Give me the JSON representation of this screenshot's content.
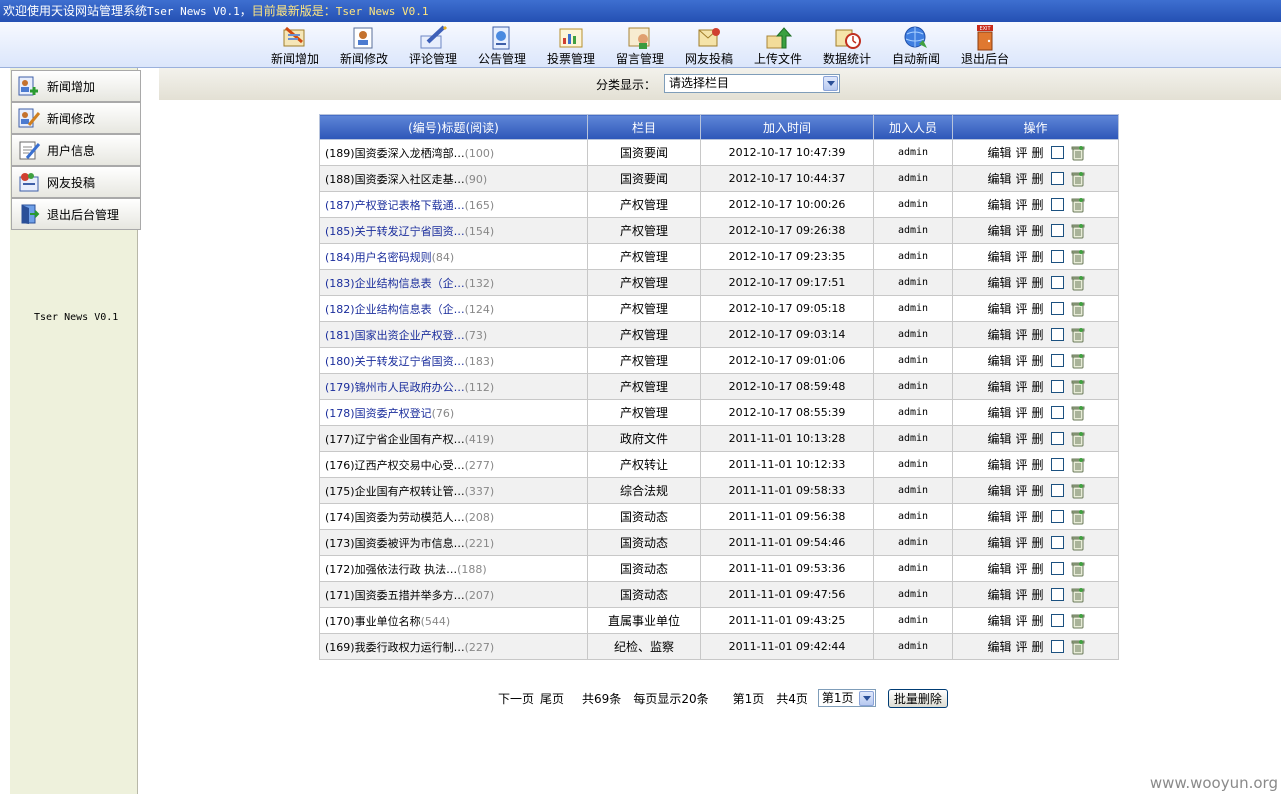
{
  "topbar": {
    "welcome": "欢迎使用天设网站管理系统",
    "version": "Tser News V0.1",
    "sep": "，",
    "latest_label": "目前最新版是：",
    "latest_version": "Tser News V0.1"
  },
  "toolbar": {
    "items": [
      {
        "label": "新闻增加",
        "icon": "news-add-icon"
      },
      {
        "label": "新闻修改",
        "icon": "news-edit-icon"
      },
      {
        "label": "评论管理",
        "icon": "comment-icon"
      },
      {
        "label": "公告管理",
        "icon": "notice-icon"
      },
      {
        "label": "投票管理",
        "icon": "vote-icon"
      },
      {
        "label": "留言管理",
        "icon": "message-icon"
      },
      {
        "label": "网友投稿",
        "icon": "submission-icon"
      },
      {
        "label": "上传文件",
        "icon": "upload-icon"
      },
      {
        "label": "数据统计",
        "icon": "stats-icon"
      },
      {
        "label": "自动新闻",
        "icon": "auto-news-icon"
      },
      {
        "label": "退出后台",
        "icon": "exit-icon"
      }
    ]
  },
  "sidebar": {
    "items": [
      {
        "label": "新闻增加"
      },
      {
        "label": "新闻修改"
      },
      {
        "label": "用户信息"
      },
      {
        "label": "网友投稿"
      },
      {
        "label": "退出后台管理"
      }
    ],
    "version": "Tser News V0.1"
  },
  "filter": {
    "label": "分类显示：",
    "selected": "请选择栏目"
  },
  "table": {
    "headers": [
      "(编号)标题(阅读)",
      "栏目",
      "加入时间",
      "加入人员",
      "操作"
    ],
    "op_labels": {
      "edit": "编辑",
      "comment": "评",
      "delete": "删"
    },
    "rows": [
      {
        "title": "(189)国资委深入龙栖湾部…",
        "reads": "(100)",
        "blue": false,
        "category": "国资要闻",
        "time": "2012-10-17 10:47:39",
        "user": "admin"
      },
      {
        "title": "(188)国资委深入社区走基…",
        "reads": "(90)",
        "blue": false,
        "category": "国资要闻",
        "time": "2012-10-17 10:44:37",
        "user": "admin"
      },
      {
        "title": "(187)产权登记表格下载通…",
        "reads": "(165)",
        "blue": true,
        "category": "产权管理",
        "time": "2012-10-17 10:00:26",
        "user": "admin"
      },
      {
        "title": "(185)关于转发辽宁省国资…",
        "reads": "(154)",
        "blue": true,
        "category": "产权管理",
        "time": "2012-10-17 09:26:38",
        "user": "admin"
      },
      {
        "title": "(184)用户名密码规则",
        "reads": "(84)",
        "blue": true,
        "category": "产权管理",
        "time": "2012-10-17 09:23:35",
        "user": "admin"
      },
      {
        "title": "(183)企业结构信息表（企…",
        "reads": "(132)",
        "blue": true,
        "category": "产权管理",
        "time": "2012-10-17 09:17:51",
        "user": "admin"
      },
      {
        "title": "(182)企业结构信息表（企…",
        "reads": "(124)",
        "blue": true,
        "category": "产权管理",
        "time": "2012-10-17 09:05:18",
        "user": "admin"
      },
      {
        "title": "(181)国家出资企业产权登…",
        "reads": "(73)",
        "blue": true,
        "category": "产权管理",
        "time": "2012-10-17 09:03:14",
        "user": "admin"
      },
      {
        "title": "(180)关于转发辽宁省国资…",
        "reads": "(183)",
        "blue": true,
        "category": "产权管理",
        "time": "2012-10-17 09:01:06",
        "user": "admin"
      },
      {
        "title": "(179)锦州市人民政府办公…",
        "reads": "(112)",
        "blue": true,
        "category": "产权管理",
        "time": "2012-10-17 08:59:48",
        "user": "admin"
      },
      {
        "title": "(178)国资委产权登记",
        "reads": "(76)",
        "blue": true,
        "category": "产权管理",
        "time": "2012-10-17 08:55:39",
        "user": "admin"
      },
      {
        "title": "(177)辽宁省企业国有产权…",
        "reads": "(419)",
        "blue": false,
        "category": "政府文件",
        "time": "2011-11-01 10:13:28",
        "user": "admin"
      },
      {
        "title": "(176)辽西产权交易中心受…",
        "reads": "(277)",
        "blue": false,
        "category": "产权转让",
        "time": "2011-11-01 10:12:33",
        "user": "admin"
      },
      {
        "title": "(175)企业国有产权转让管…",
        "reads": "(337)",
        "blue": false,
        "category": "综合法规",
        "time": "2011-11-01 09:58:33",
        "user": "admin"
      },
      {
        "title": "(174)国资委为劳动模范人…",
        "reads": "(208)",
        "blue": false,
        "category": "国资动态",
        "time": "2011-11-01 09:56:38",
        "user": "admin"
      },
      {
        "title": "(173)国资委被评为市信息…",
        "reads": "(221)",
        "blue": false,
        "category": "国资动态",
        "time": "2011-11-01 09:54:46",
        "user": "admin"
      },
      {
        "title": "(172)加强依法行政 执法…",
        "reads": "(188)",
        "blue": false,
        "category": "国资动态",
        "time": "2011-11-01 09:53:36",
        "user": "admin"
      },
      {
        "title": "(171)国资委五措并举多方…",
        "reads": "(207)",
        "blue": false,
        "category": "国资动态",
        "time": "2011-11-01 09:47:56",
        "user": "admin"
      },
      {
        "title": "(170)事业单位名称",
        "reads": "(544)",
        "blue": false,
        "category": "直属事业单位",
        "time": "2011-11-01 09:43:25",
        "user": "admin"
      },
      {
        "title": "(169)我委行政权力运行制…",
        "reads": "(227)",
        "blue": false,
        "category": "纪检、监察",
        "time": "2011-11-01 09:42:44",
        "user": "admin"
      }
    ]
  },
  "pager": {
    "next": "下一页",
    "last": "尾页",
    "total": "共69条",
    "per_page": "每页显示20条",
    "current": "第1页",
    "pages": "共4页",
    "select_value": "第1页",
    "batch_delete": "批量删除"
  },
  "watermark": "www.wooyun.org"
}
